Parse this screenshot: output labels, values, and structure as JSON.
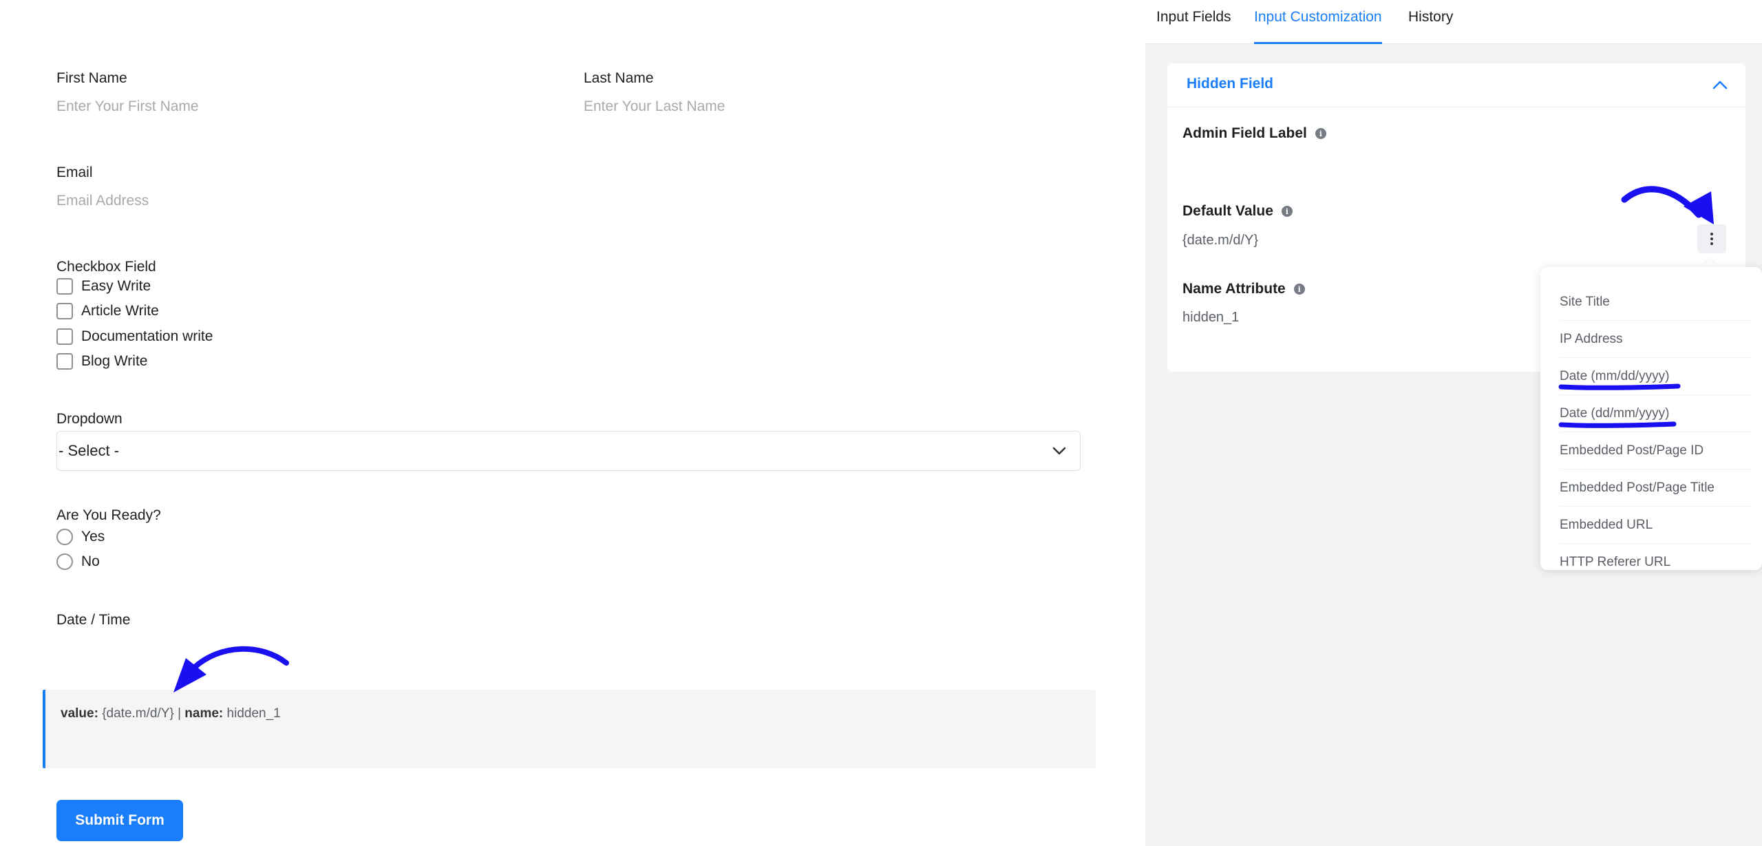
{
  "form": {
    "first_name": {
      "label": "First Name",
      "placeholder": "Enter Your First Name"
    },
    "last_name": {
      "label": "Last Name",
      "placeholder": "Enter Your Last Name"
    },
    "email": {
      "label": "Email",
      "placeholder": "Email Address"
    },
    "checkbox_field": {
      "label": "Checkbox Field",
      "options": [
        "Easy Write",
        "Article Write",
        "Documentation write",
        "Blog Write"
      ]
    },
    "dropdown": {
      "label": "Dropdown",
      "selected": "- Select -"
    },
    "radio_field": {
      "label": "Are You Ready?",
      "options": [
        "Yes",
        "No"
      ]
    },
    "datetime": {
      "label": "Date / Time"
    },
    "hidden_preview": {
      "value_label": "value:",
      "value": "{date.m/d/Y}",
      "separator": "|",
      "name_label": "name:",
      "name": "hidden_1"
    },
    "submit_label": "Submit Form"
  },
  "settings": {
    "tabs": [
      {
        "label": "Input Fields",
        "active": false
      },
      {
        "label": "Input Customization",
        "active": true
      },
      {
        "label": "History",
        "active": false
      }
    ],
    "card": {
      "title": "Hidden Field",
      "admin_field_label": {
        "label": "Admin Field Label",
        "value": ""
      },
      "default_value": {
        "label": "Default Value",
        "value": "{date.m/d/Y}"
      },
      "name_attribute": {
        "label": "Name Attribute",
        "value": "hidden_1"
      }
    },
    "smartcode_menu": {
      "items": [
        "Site Title",
        "IP Address",
        "Date (mm/dd/yyyy)",
        "Date (dd/mm/yyyy)",
        "Embedded Post/Page ID",
        "Embedded Post/Page Title",
        "Embedded URL",
        "HTTP Referer URL"
      ],
      "highlighted": [
        "Date (mm/dd/yyyy)",
        "Date (dd/mm/yyyy)"
      ]
    }
  },
  "colors": {
    "accent": "#1a7efb",
    "annotation": "#1a0ff0",
    "panel_bg": "#f2f3f5"
  },
  "icons": {
    "info": "info-icon",
    "chevron_down": "chevron-down-icon",
    "chevron_up": "chevron-up-icon",
    "kebab": "more-vertical-icon",
    "arrow": "annotation-arrow-icon"
  }
}
